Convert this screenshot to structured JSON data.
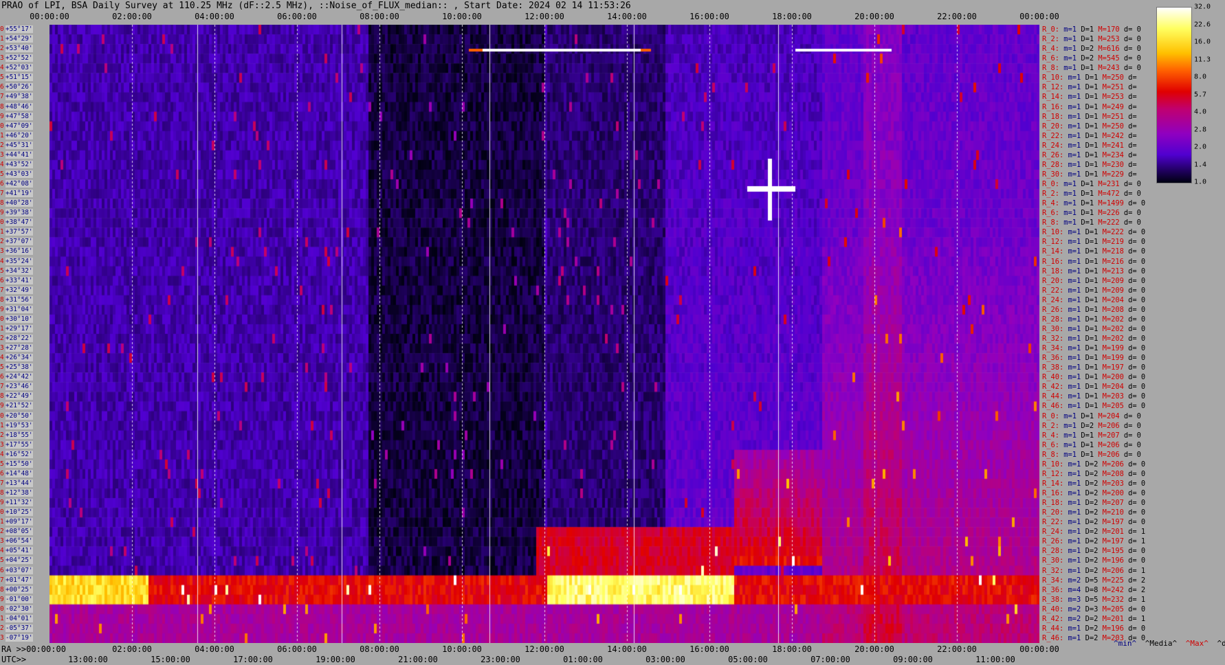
{
  "title": "PRAO of LPI, BSA Daily Survey at 110.25 MHz (dF::2.5 MHz), ::Noise_of_FLUX_median:: , Start Date: 2024 02 14 11:53:26",
  "top_axis": [
    "00:00:00",
    "02:00:00",
    "04:00:00",
    "06:00:00",
    "08:00:00",
    "10:00:00",
    "12:00:00",
    "14:00:00",
    "16:00:00",
    "18:00:00",
    "20:00:00",
    "22:00:00",
    "00:00:00"
  ],
  "ra_axis": {
    "label": "RA >>00:00:00",
    "ticks": [
      "02:00:00",
      "04:00:00",
      "06:00:00",
      "08:00:00",
      "10:00:00",
      "12:00:00",
      "14:00:00",
      "16:00:00",
      "18:00:00",
      "20:00:00",
      "22:00:00",
      "00:00:00"
    ]
  },
  "utc_axis": {
    "label": "UTC>>",
    "ticks": [
      "13:00:00",
      "15:00:00",
      "17:00:00",
      "19:00:00",
      "21:00:00",
      "23:00:00",
      "01:00:00",
      "03:00:00",
      "05:00:00",
      "07:00:00",
      "09:00:00",
      "11:00:00"
    ]
  },
  "colorbar": {
    "ticks": [
      "32.0",
      "22.6",
      "16.0",
      "11.3",
      "8.0",
      "5.7",
      "4.0",
      "2.8",
      "2.0",
      "1.4",
      "1.0"
    ]
  },
  "rows": [
    {
      "i": "0",
      "dec": "+55°17'"
    },
    {
      "i": "1",
      "dec": "+54°29'"
    },
    {
      "i": "2",
      "dec": "+53°40'"
    },
    {
      "i": "3",
      "dec": "+52°52'"
    },
    {
      "i": "4",
      "dec": "+52°03'"
    },
    {
      "i": "5",
      "dec": "+51°15'"
    },
    {
      "i": "6",
      "dec": "+50°26'"
    },
    {
      "i": "7",
      "dec": "+49°38'"
    },
    {
      "i": "8",
      "dec": "+48°46'"
    },
    {
      "i": "9",
      "dec": "+47°58'"
    },
    {
      "i": "10",
      "dec": "+47°09'"
    },
    {
      "i": "11",
      "dec": "+46°20'"
    },
    {
      "i": "12",
      "dec": "+45°31'"
    },
    {
      "i": "13",
      "dec": "+44°41'"
    },
    {
      "i": "14",
      "dec": "+43°52'"
    },
    {
      "i": "15",
      "dec": "+43°03'"
    },
    {
      "i": "16",
      "dec": "+42°08'"
    },
    {
      "i": "17",
      "dec": "+41°19'"
    },
    {
      "i": "18",
      "dec": "+40°28'"
    },
    {
      "i": "19",
      "dec": "+39°38'"
    },
    {
      "i": "20",
      "dec": "+38°47'"
    },
    {
      "i": "21",
      "dec": "+37°57'"
    },
    {
      "i": "22",
      "dec": "+37°07'"
    },
    {
      "i": "23",
      "dec": "+36°16'"
    },
    {
      "i": "24",
      "dec": "+35°24'"
    },
    {
      "i": "25",
      "dec": "+34°32'"
    },
    {
      "i": "26",
      "dec": "+33°41'"
    },
    {
      "i": "27",
      "dec": "+32°49'"
    },
    {
      "i": "28",
      "dec": "+31°56'"
    },
    {
      "i": "29",
      "dec": "+31°04'"
    },
    {
      "i": "30",
      "dec": "+30°10'"
    },
    {
      "i": "31",
      "dec": "+29°17'"
    },
    {
      "i": "32",
      "dec": "+28°22'"
    },
    {
      "i": "33",
      "dec": "+27°28'"
    },
    {
      "i": "34",
      "dec": "+26°34'"
    },
    {
      "i": "35",
      "dec": "+25°38'"
    },
    {
      "i": "36",
      "dec": "+24°42'"
    },
    {
      "i": "37",
      "dec": "+23°46'"
    },
    {
      "i": "38",
      "dec": "+22°49'"
    },
    {
      "i": "39",
      "dec": "+21°52'"
    },
    {
      "i": "40",
      "dec": "+20°50'"
    },
    {
      "i": "41",
      "dec": "+19°53'"
    },
    {
      "i": "42",
      "dec": "+18°55'"
    },
    {
      "i": "43",
      "dec": "+17°55'"
    },
    {
      "i": "44",
      "dec": "+16°52'"
    },
    {
      "i": "45",
      "dec": "+15°50'"
    },
    {
      "i": "46",
      "dec": "+14°48'"
    },
    {
      "i": "47",
      "dec": "+13°44'"
    },
    {
      "i": "48",
      "dec": "+12°38'"
    },
    {
      "i": "49",
      "dec": "+11°32'"
    },
    {
      "i": "50",
      "dec": "+10°25'"
    },
    {
      "i": "51",
      "dec": "+09°17'"
    },
    {
      "i": "52",
      "dec": "+08°05'"
    },
    {
      "i": "53",
      "dec": "+06°54'"
    },
    {
      "i": "54",
      "dec": "+05°41'"
    },
    {
      "i": "55",
      "dec": "+04°25'"
    },
    {
      "i": "56",
      "dec": "+03°07'"
    },
    {
      "i": "57",
      "dec": "+01°47'"
    },
    {
      "i": "58",
      "dec": "+00°25'"
    },
    {
      "i": "59",
      "dec": "-01°00'"
    },
    {
      "i": "60",
      "dec": "-02°30'"
    },
    {
      "i": "61",
      "dec": "-04°01'"
    },
    {
      "i": "62",
      "dec": "-05°37'"
    },
    {
      "i": "63",
      "dec": "-07°19'"
    }
  ],
  "stats": [
    {
      "r": "R_0:",
      "m": "m=1",
      "d": "D=1",
      "M": "M=170",
      "dv": "d= 0"
    },
    {
      "r": "R_2:",
      "m": "m=1",
      "d": "D=1",
      "M": "M=253",
      "dv": "d= 0"
    },
    {
      "r": "R_4:",
      "m": "m=1",
      "d": "D=2",
      "M": "M=616",
      "dv": "d= 0"
    },
    {
      "r": "R_6:",
      "m": "m=1",
      "d": "D=2",
      "M": "M=545",
      "dv": "d= 0"
    },
    {
      "r": "R_8:",
      "m": "m=1",
      "d": "D=1",
      "M": "M=243",
      "dv": "d= 0"
    },
    {
      "r": "R_10:",
      "m": "m=1",
      "d": "D=1",
      "M": "M=250",
      "dv": "d="
    },
    {
      "r": "R_12:",
      "m": "m=1",
      "d": "D=1",
      "M": "M=251",
      "dv": "d="
    },
    {
      "r": "R_14:",
      "m": "m=1",
      "d": "D=1",
      "M": "M=253",
      "dv": "d="
    },
    {
      "r": "R_16:",
      "m": "m=1",
      "d": "D=1",
      "M": "M=249",
      "dv": "d="
    },
    {
      "r": "R_18:",
      "m": "m=1",
      "d": "D=1",
      "M": "M=251",
      "dv": "d="
    },
    {
      "r": "R_20:",
      "m": "m=1",
      "d": "D=1",
      "M": "M=250",
      "dv": "d="
    },
    {
      "r": "R_22:",
      "m": "m=1",
      "d": "D=1",
      "M": "M=242",
      "dv": "d="
    },
    {
      "r": "R_24:",
      "m": "m=1",
      "d": "D=1",
      "M": "M=241",
      "dv": "d="
    },
    {
      "r": "R_26:",
      "m": "m=1",
      "d": "D=1",
      "M": "M=234",
      "dv": "d="
    },
    {
      "r": "R_28:",
      "m": "m=1",
      "d": "D=1",
      "M": "M=230",
      "dv": "d="
    },
    {
      "r": "R_30:",
      "m": "m=1",
      "d": "D=1",
      "M": "M=229",
      "dv": "d="
    },
    {
      "r": "R_0:",
      "m": "m=1",
      "d": "D=1",
      "M": "M=231",
      "dv": "d= 0"
    },
    {
      "r": "R_2:",
      "m": "m=1",
      "d": "D=1",
      "M": "M=472",
      "dv": "d= 0"
    },
    {
      "r": "R_4:",
      "m": "m=1",
      "d": "D=1",
      "M": "M=1499",
      "dv": "d= 0"
    },
    {
      "r": "R_6:",
      "m": "m=1",
      "d": "D=1",
      "M": "M=226",
      "dv": "d= 0"
    },
    {
      "r": "R_8:",
      "m": "m=1",
      "d": "D=1",
      "M": "M=222",
      "dv": "d= 0"
    },
    {
      "r": "R_10:",
      "m": "m=1",
      "d": "D=1",
      "M": "M=222",
      "dv": "d= 0"
    },
    {
      "r": "R_12:",
      "m": "m=1",
      "d": "D=1",
      "M": "M=219",
      "dv": "d= 0"
    },
    {
      "r": "R_14:",
      "m": "m=1",
      "d": "D=1",
      "M": "M=218",
      "dv": "d= 0"
    },
    {
      "r": "R_16:",
      "m": "m=1",
      "d": "D=1",
      "M": "M=216",
      "dv": "d= 0"
    },
    {
      "r": "R_18:",
      "m": "m=1",
      "d": "D=1",
      "M": "M=213",
      "dv": "d= 0"
    },
    {
      "r": "R_20:",
      "m": "m=1",
      "d": "D=1",
      "M": "M=209",
      "dv": "d= 0"
    },
    {
      "r": "R_22:",
      "m": "m=1",
      "d": "D=1",
      "M": "M=209",
      "dv": "d= 0"
    },
    {
      "r": "R_24:",
      "m": "m=1",
      "d": "D=1",
      "M": "M=204",
      "dv": "d= 0"
    },
    {
      "r": "R_26:",
      "m": "m=1",
      "d": "D=1",
      "M": "M=208",
      "dv": "d= 0"
    },
    {
      "r": "R_28:",
      "m": "m=1",
      "d": "D=1",
      "M": "M=202",
      "dv": "d= 0"
    },
    {
      "r": "R_30:",
      "m": "m=1",
      "d": "D=1",
      "M": "M=202",
      "dv": "d= 0"
    },
    {
      "r": "R_32:",
      "m": "m=1",
      "d": "D=1",
      "M": "M=202",
      "dv": "d= 0"
    },
    {
      "r": "R_34:",
      "m": "m=1",
      "d": "D=1",
      "M": "M=199",
      "dv": "d= 0"
    },
    {
      "r": "R_36:",
      "m": "m=1",
      "d": "D=1",
      "M": "M=199",
      "dv": "d= 0"
    },
    {
      "r": "R_38:",
      "m": "m=1",
      "d": "D=1",
      "M": "M=197",
      "dv": "d= 0"
    },
    {
      "r": "R_40:",
      "m": "m=1",
      "d": "D=1",
      "M": "M=200",
      "dv": "d= 0"
    },
    {
      "r": "R_42:",
      "m": "m=1",
      "d": "D=1",
      "M": "M=204",
      "dv": "d= 0"
    },
    {
      "r": "R_44:",
      "m": "m=1",
      "d": "D=1",
      "M": "M=203",
      "dv": "d= 0"
    },
    {
      "r": "R_46:",
      "m": "m=1",
      "d": "D=1",
      "M": "M=205",
      "dv": "d= 0"
    },
    {
      "r": "R_0:",
      "m": "m=1",
      "d": "D=1",
      "M": "M=204",
      "dv": "d= 0"
    },
    {
      "r": "R_2:",
      "m": "m=1",
      "d": "D=2",
      "M": "M=206",
      "dv": "d= 0"
    },
    {
      "r": "R_4:",
      "m": "m=1",
      "d": "D=1",
      "M": "M=207",
      "dv": "d= 0"
    },
    {
      "r": "R_6:",
      "m": "m=1",
      "d": "D=1",
      "M": "M=206",
      "dv": "d= 0"
    },
    {
      "r": "R_8:",
      "m": "m=1",
      "d": "D=1",
      "M": "M=206",
      "dv": "d= 0"
    },
    {
      "r": "R_10:",
      "m": "m=1",
      "d": "D=2",
      "M": "M=206",
      "dv": "d= 0"
    },
    {
      "r": "R_12:",
      "m": "m=1",
      "d": "D=2",
      "M": "M=208",
      "dv": "d= 0"
    },
    {
      "r": "R_14:",
      "m": "m=1",
      "d": "D=2",
      "M": "M=203",
      "dv": "d= 0"
    },
    {
      "r": "R_16:",
      "m": "m=1",
      "d": "D=2",
      "M": "M=200",
      "dv": "d= 0"
    },
    {
      "r": "R_18:",
      "m": "m=1",
      "d": "D=2",
      "M": "M=207",
      "dv": "d= 0"
    },
    {
      "r": "R_20:",
      "m": "m=1",
      "d": "D=2",
      "M": "M=210",
      "dv": "d= 0"
    },
    {
      "r": "R_22:",
      "m": "m=1",
      "d": "D=2",
      "M": "M=197",
      "dv": "d= 0"
    },
    {
      "r": "R_24:",
      "m": "m=1",
      "d": "D=2",
      "M": "M=201",
      "dv": "d= 1"
    },
    {
      "r": "R_26:",
      "m": "m=1",
      "d": "D=2",
      "M": "M=197",
      "dv": "d= 1"
    },
    {
      "r": "R_28:",
      "m": "m=1",
      "d": "D=2",
      "M": "M=195",
      "dv": "d= 0"
    },
    {
      "r": "R_30:",
      "m": "m=1",
      "d": "D=2",
      "M": "M=196",
      "dv": "d= 0"
    },
    {
      "r": "R_32:",
      "m": "m=1",
      "d": "D=2",
      "M": "M=206",
      "dv": "d= 1"
    },
    {
      "r": "R_34:",
      "m": "m=2",
      "d": "D=5",
      "M": "M=225",
      "dv": "d= 2"
    },
    {
      "r": "R_36:",
      "m": "m=4",
      "d": "D=8",
      "M": "M=242",
      "dv": "d= 2"
    },
    {
      "r": "R_38:",
      "m": "m=3",
      "d": "D=5",
      "M": "M=232",
      "dv": "d= 1"
    },
    {
      "r": "R_40:",
      "m": "m=2",
      "d": "D=3",
      "M": "M=205",
      "dv": "d= 0"
    },
    {
      "r": "R_42:",
      "m": "m=2",
      "d": "D=2",
      "M": "M=201",
      "dv": "d= 1"
    },
    {
      "r": "R_44:",
      "m": "m=1",
      "d": "D=2",
      "M": "M=196",
      "dv": "d= 0"
    },
    {
      "r": "R_46:",
      "m": "m=1",
      "d": "D=2",
      "M": "M=203",
      "dv": "d= 0"
    }
  ],
  "footer": {
    "min": "^min^",
    "median": "^Media^",
    "max": "^Max^",
    "devia": "^devia^"
  },
  "chart_data": {
    "type": "heatmap",
    "title": "PRAO of LPI, BSA Daily Survey at 110.25 MHz (dF::2.5 MHz), ::Noise_of_FLUX_median:: , Start Date: 2024 02 14 11:53:26",
    "x_axis": "sidereal time 00:00:00 to 24:00:00",
    "y_axis": "declination +55°17' to -07°19' (64 beams)",
    "color_scale": {
      "min": 1.0,
      "max": 32.0,
      "scale": "log2"
    },
    "notable": [
      {
        "name": "bright band",
        "dec_rows": [
          57,
          59
        ],
        "intensity": "high (16-32)"
      },
      {
        "name": "strong source",
        "ra": "19:48",
        "dec": "+41°19'",
        "intensity": "saturated"
      },
      {
        "name": "horizontal streak",
        "dec": "+52°52'",
        "ra_range": [
          "12:00",
          "16:20"
        ],
        "intensity": "saturated"
      }
    ]
  }
}
